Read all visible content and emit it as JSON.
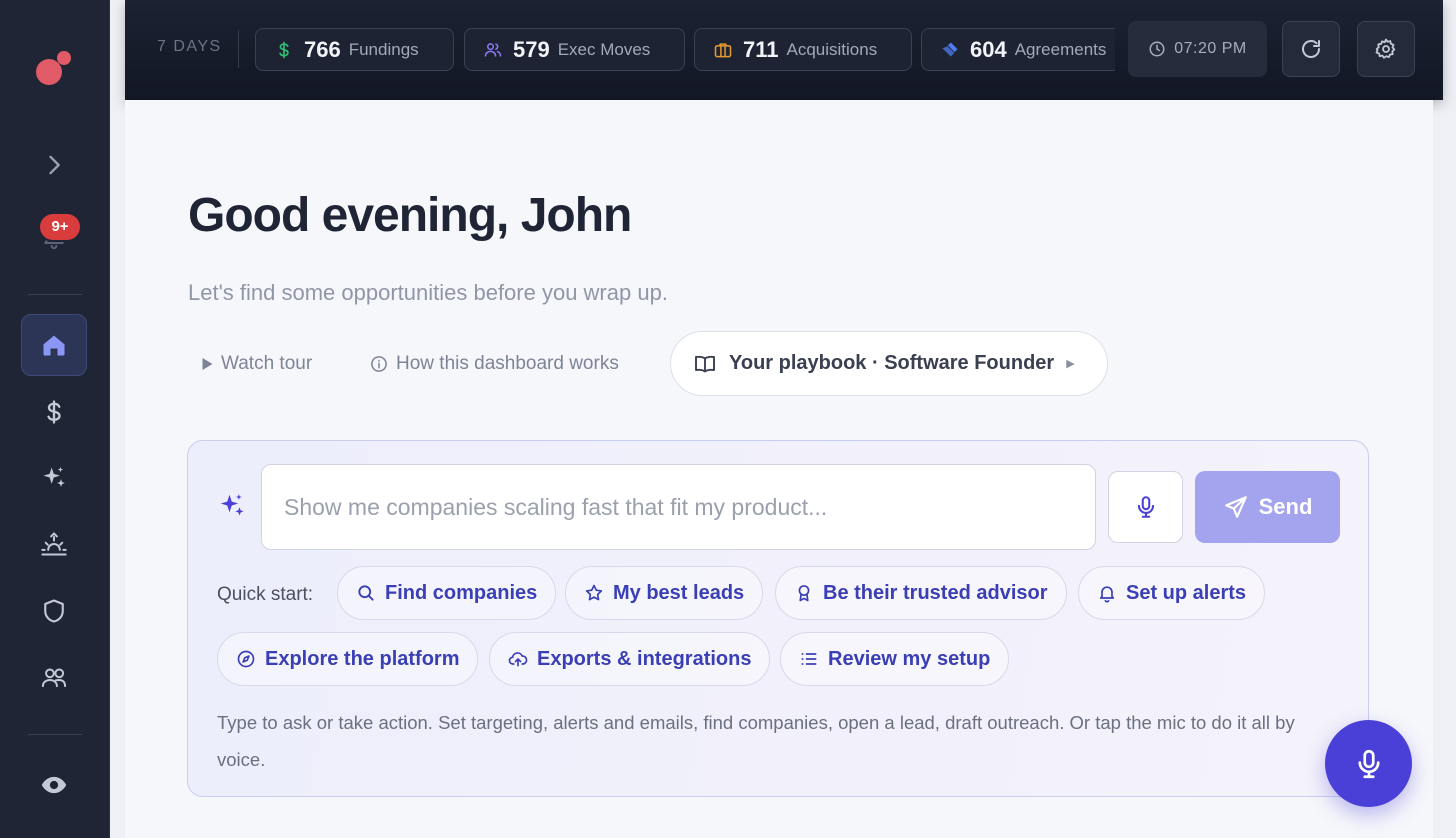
{
  "sidebar": {
    "notification_badge": "9+",
    "items": [
      {
        "name": "expand",
        "icon": "chevron-right-icon"
      },
      {
        "name": "notifications",
        "icon": "bell-icon"
      },
      {
        "name": "home",
        "icon": "home-icon",
        "active": true
      },
      {
        "name": "fundings",
        "icon": "dollar-icon"
      },
      {
        "name": "ai",
        "icon": "sparkle-icon"
      },
      {
        "name": "signals",
        "icon": "sunrise-icon"
      },
      {
        "name": "security",
        "icon": "shield-icon"
      },
      {
        "name": "team",
        "icon": "users-icon"
      },
      {
        "name": "watch",
        "icon": "eye-icon"
      }
    ]
  },
  "topbar": {
    "period": "7 DAYS",
    "stats": [
      {
        "value": "766",
        "label": "Fundings",
        "icon": "dollar-icon",
        "color": "#2fbf71"
      },
      {
        "value": "579",
        "label": "Exec Moves",
        "icon": "users-icon",
        "color": "#8b7cf6"
      },
      {
        "value": "711",
        "label": "Acquisitions",
        "icon": "briefcase-icon",
        "color": "#e79b2f"
      },
      {
        "value": "604",
        "label": "Agreements",
        "icon": "handshake-icon",
        "color": "#4f7cf0"
      }
    ],
    "time": "07:20 PM"
  },
  "main": {
    "greeting": "Good evening, John",
    "subtitle": "Let's find some opportunities before you wrap up.",
    "watch_tour": "Watch tour",
    "how_it_works": "How this dashboard works",
    "playbook": "Your playbook · Software Founder"
  },
  "assistant": {
    "placeholder": "Show me companies scaling fast that fit my product...",
    "send_label": "Send",
    "quick_start_label": "Quick start:",
    "chips": [
      {
        "label": "Find companies",
        "icon": "search-icon"
      },
      {
        "label": "My best leads",
        "icon": "star-icon"
      },
      {
        "label": "Be their trusted advisor",
        "icon": "award-icon"
      },
      {
        "label": "Set up alerts",
        "icon": "bell-icon"
      },
      {
        "label": "Explore the platform",
        "icon": "compass-icon"
      },
      {
        "label": "Exports & integrations",
        "icon": "upload-cloud-icon"
      },
      {
        "label": "Review my setup",
        "icon": "list-icon"
      }
    ],
    "helper_text": "Type to ask or take action. Set targeting, alerts and emails, find companies, open a lead, draft outreach. Or tap the mic to do it all by voice."
  },
  "colors": {
    "accent": "#4a3fd7",
    "sidebar_bg": "#1f2535",
    "badge": "#d93c3c"
  }
}
